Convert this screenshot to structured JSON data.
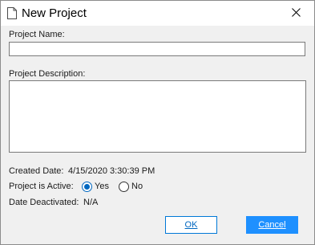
{
  "window": {
    "title": "New Project"
  },
  "form": {
    "project_name_label": "Project Name:",
    "project_name_value": "",
    "project_description_label": "Project Description:",
    "project_description_value": "",
    "created_date_label": "Created Date:",
    "created_date_value": "4/15/2020 3:30:39 PM",
    "active_label": "Project is Active:",
    "active_options": [
      {
        "label": "Yes",
        "checked": true
      },
      {
        "label": "No",
        "checked": false
      }
    ],
    "date_deactivated_label": "Date Deactivated:",
    "date_deactivated_value": "N/A"
  },
  "buttons": {
    "ok_label": "OK",
    "cancel_label": "Cancel"
  },
  "colors": {
    "accent": "#0067c0",
    "cancel_bg": "#1e90ff",
    "dialog_bg": "#f0f0f0"
  },
  "icons": {
    "title": "document-icon",
    "close": "close-icon"
  }
}
